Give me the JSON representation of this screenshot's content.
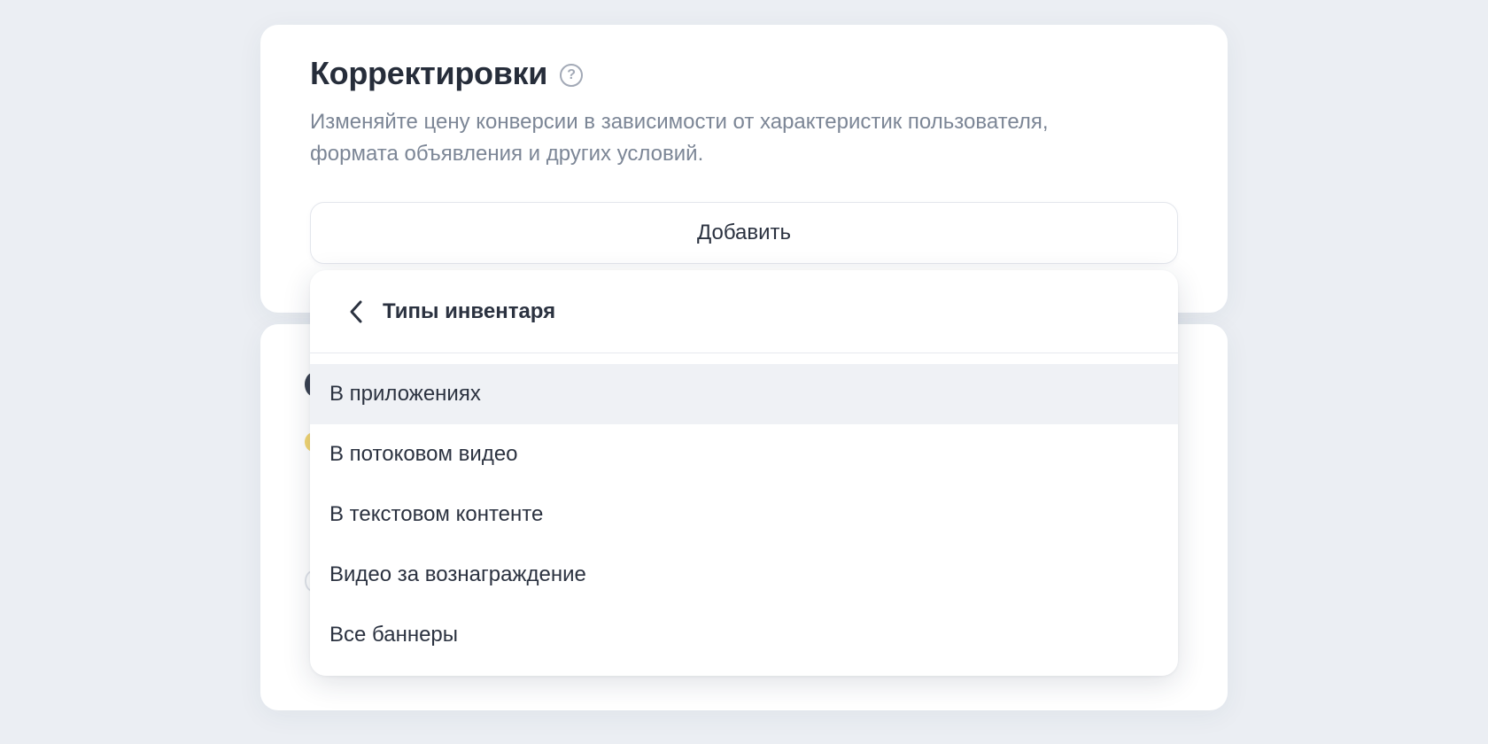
{
  "adjustments": {
    "title": "Корректировки",
    "help_icon": "question-circle-icon",
    "description": "Изменяйте цену конверсии в зависимости от характеристик пользователя, формата объявления и других условий.",
    "add_label": "Добавить"
  },
  "dropdown": {
    "back_icon": "chevron-left-icon",
    "title": "Типы инвентаря",
    "options": [
      {
        "label": "В приложениях",
        "highlighted": true
      },
      {
        "label": "В потоковом видео",
        "highlighted": false
      },
      {
        "label": "В текстовом контенте",
        "highlighted": false
      },
      {
        "label": "Видео за вознаграждение",
        "highlighted": false
      },
      {
        "label": "Все баннеры",
        "highlighted": false
      }
    ]
  },
  "colors": {
    "background": "#ebeef3",
    "card": "#ffffff",
    "highlight": "#eff1f5",
    "text": "#2b3240",
    "muted_text": "#7c8696"
  }
}
